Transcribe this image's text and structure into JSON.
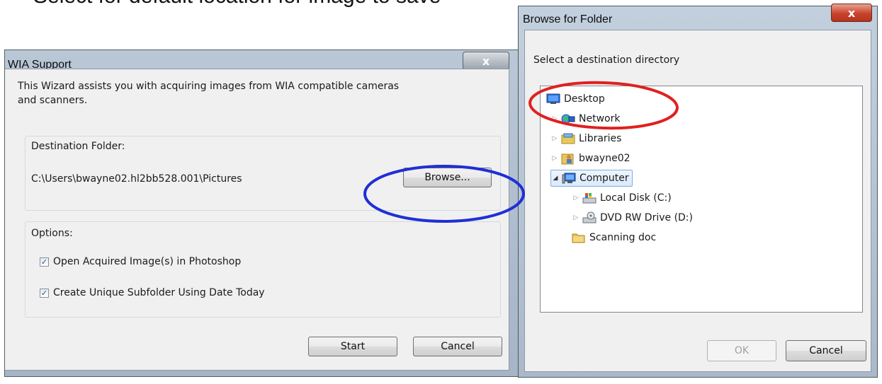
{
  "caption": "Select for default location for image to save",
  "wia_dialog": {
    "title": "WIA Support",
    "close_glyph": "x",
    "intro": "This Wizard assists you with acquiring images from WIA compatible cameras\n and scanners.",
    "destination_group": {
      "label": "Destination Folder:",
      "path": "C:\\Users\\bwayne02.hl2bb528.001\\Pictures",
      "browse_label": "Browse..."
    },
    "options_group": {
      "label": "Options:",
      "items": [
        {
          "label": "Open Acquired Image(s) in Photoshop",
          "checked": true
        },
        {
          "label": "Create Unique Subfolder Using Date Today",
          "checked": true
        }
      ]
    },
    "start_label": "Start",
    "cancel_label": "Cancel"
  },
  "browse_dialog": {
    "title": "Browse for Folder",
    "close_glyph": "x",
    "instruction": "Select a destination directory",
    "tree": [
      {
        "label": "Desktop",
        "icon": "desktop-icon",
        "level": 0,
        "expander": ""
      },
      {
        "label": "Network",
        "icon": "network-icon",
        "level": 1,
        "expander": "▷"
      },
      {
        "label": "Libraries",
        "icon": "libraries-icon",
        "level": 1,
        "expander": "▷"
      },
      {
        "label": "bwayne02",
        "icon": "user-folder-icon",
        "level": 1,
        "expander": "▷"
      },
      {
        "label": "Computer",
        "icon": "computer-icon",
        "level": 1,
        "expander": "◢",
        "selected": true
      },
      {
        "label": "Local Disk (C:)",
        "icon": "local-disk-icon",
        "level": 2,
        "expander": "▷"
      },
      {
        "label": "DVD RW Drive (D:)",
        "icon": "dvd-drive-icon",
        "level": 2,
        "expander": "▷"
      },
      {
        "label": "Scanning doc",
        "icon": "folder-icon",
        "level": 1,
        "expander": ""
      }
    ],
    "ok_label": "OK",
    "cancel_label": "Cancel"
  },
  "annotations": {
    "blue_ellipse_color": "#1f2fd6",
    "red_ellipse_color": "#e02020"
  }
}
